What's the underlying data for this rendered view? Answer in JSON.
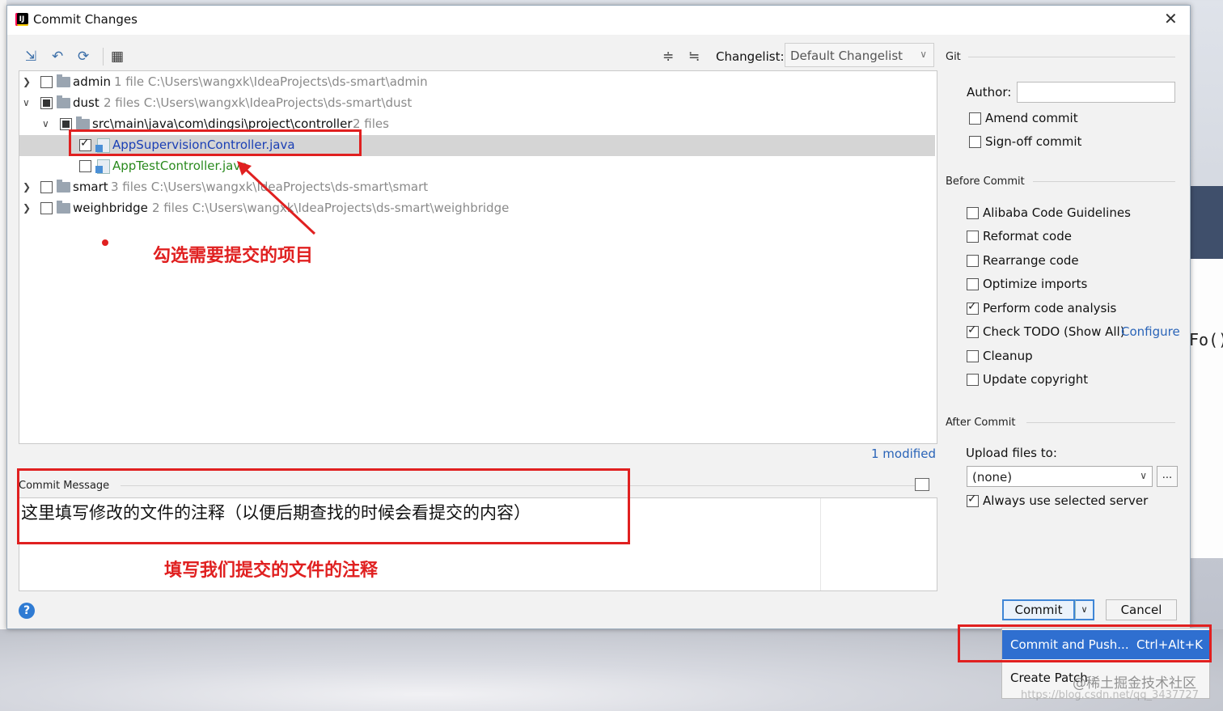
{
  "window": {
    "title": "Commit Changes",
    "close": "✕",
    "app_icon_text": "IJ"
  },
  "toolbar": {
    "changelist_label": "Changelist:",
    "changelist_value": "Default Changelist"
  },
  "tree": {
    "rows": [
      {
        "name": "admin",
        "info": "1 file  C:\\Users\\wangxk\\IdeaProjects\\ds-smart\\admin"
      },
      {
        "name": "dust",
        "info": "2 files  C:\\Users\\wangxk\\IdeaProjects\\ds-smart\\dust"
      },
      {
        "name": "src\\main\\java\\com\\dingsi\\project\\controller",
        "info": "2 files"
      },
      {
        "name": "AppSupervisionController.java",
        "info": ""
      },
      {
        "name": "AppTestController.java",
        "info": ""
      },
      {
        "name": "smart",
        "info": "3 files  C:\\Users\\wangxk\\IdeaProjects\\ds-smart\\smart"
      },
      {
        "name": "weighbridge",
        "info": "2 files  C:\\Users\\wangxk\\IdeaProjects\\ds-smart\\weighbridge"
      }
    ],
    "status": "1 modified"
  },
  "annotations": {
    "select_projects": "勾选需要提交的项目",
    "fill_comment": "填写我们提交的文件的注释"
  },
  "commit_message": {
    "label": "Commit Message",
    "text": "这里填写修改的文件的注释（以便后期查找的时候会看提交的内容）"
  },
  "git_panel": {
    "section": "Git",
    "author_label": "Author:",
    "author_value": "",
    "amend": "Amend commit",
    "signoff": "Sign-off commit"
  },
  "before_commit": {
    "section": "Before Commit",
    "options": [
      {
        "label": "Alibaba Code Guidelines",
        "checked": false
      },
      {
        "label": "Reformat code",
        "checked": false
      },
      {
        "label": "Rearrange code",
        "checked": false
      },
      {
        "label": "Optimize imports",
        "checked": false
      },
      {
        "label": "Perform code analysis",
        "checked": true
      },
      {
        "label": "Check TODO (Show All)",
        "checked": true
      },
      {
        "label": "Cleanup",
        "checked": false
      },
      {
        "label": "Update copyright",
        "checked": false
      }
    ],
    "configure_link": "Configure"
  },
  "after_commit": {
    "section": "After Commit",
    "upload_label": "Upload files to:",
    "upload_value": "(none)",
    "dots": "...",
    "always_use": "Always use selected server"
  },
  "buttons": {
    "commit": "Commit",
    "cancel": "Cancel",
    "help": "?"
  },
  "popup": {
    "commit_push": "Commit and Push...",
    "commit_push_shortcut": "Ctrl+Alt+K",
    "create_patch": "Create Patch"
  },
  "background": {
    "code_fragment": "Fo()"
  },
  "watermark": {
    "line1": "@稀土掘金技术社区",
    "line2": "https://blog.csdn.net/qq_3437727"
  },
  "colors": {
    "accent": "#2f6fd0",
    "annotation_red": "#e02020",
    "link": "#2a64b8",
    "added_file": "#2a8a1e"
  }
}
